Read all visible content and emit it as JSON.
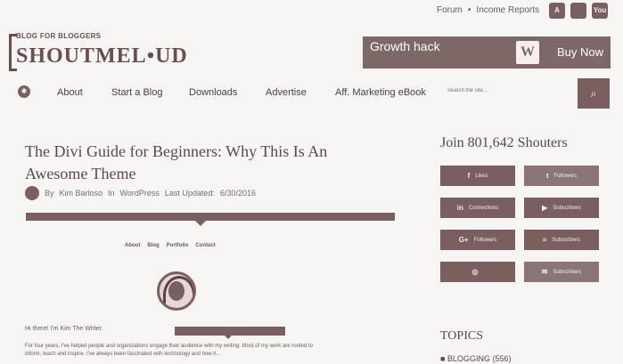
{
  "top": {
    "links": [
      "Forum",
      "Income Reports"
    ],
    "separator": "•",
    "social": [
      {
        "icon": "android-icon",
        "glyph": "A"
      },
      {
        "icon": "apple-icon",
        "glyph": ""
      },
      {
        "icon": "youtube-icon",
        "glyph": "You"
      }
    ]
  },
  "logo": {
    "tagline": "BLOG FOR BLOGGERS",
    "word": "SHOUTMEL•UD"
  },
  "ad": {
    "headline": "Growth hack",
    "badge": "W",
    "cta": "Buy Now"
  },
  "nav": {
    "home_icon": "✱",
    "items": [
      "About",
      "Start a Blog",
      "Downloads",
      "Advertise",
      "Aff. Marketing eBook"
    ],
    "search_placeholder": "Search the site...",
    "search_icon": "⌕"
  },
  "article": {
    "title": "The Divi Guide for Beginners: Why This Is An Awesome Theme",
    "by": "By",
    "author": "Kim Barloso",
    "in": "In",
    "category": "WordPress",
    "updated_label": "Last Updated:",
    "updated_date": "6/30/2016",
    "mini_menu": [
      "About",
      "Blog",
      "Portfolio",
      "Contact"
    ],
    "hello": "Hi there! I'm Kim The Writer.",
    "paragraph": "For four years, I've helped people and organizations engage their audience with my writing. Most of my work are rooted to inform, teach and inspire. I've always been fascinated with technology and how it..."
  },
  "sidebar": {
    "join": "Join 801,642 Shouters",
    "buttons": [
      {
        "icon": "f",
        "label": "Likes"
      },
      {
        "icon": "t",
        "label": "Followers"
      },
      {
        "icon": "in",
        "label": "Connections"
      },
      {
        "icon": "▶",
        "label": "Subscribers"
      },
      {
        "icon": "G+",
        "label": "Followers"
      },
      {
        "icon": "≈",
        "label": "Subscribers"
      },
      {
        "icon": "◎",
        "label": ""
      },
      {
        "icon": "✉",
        "label": "Subscribers"
      }
    ],
    "topics": "TOPICS",
    "first_topic": "BLOGGING (556)"
  }
}
